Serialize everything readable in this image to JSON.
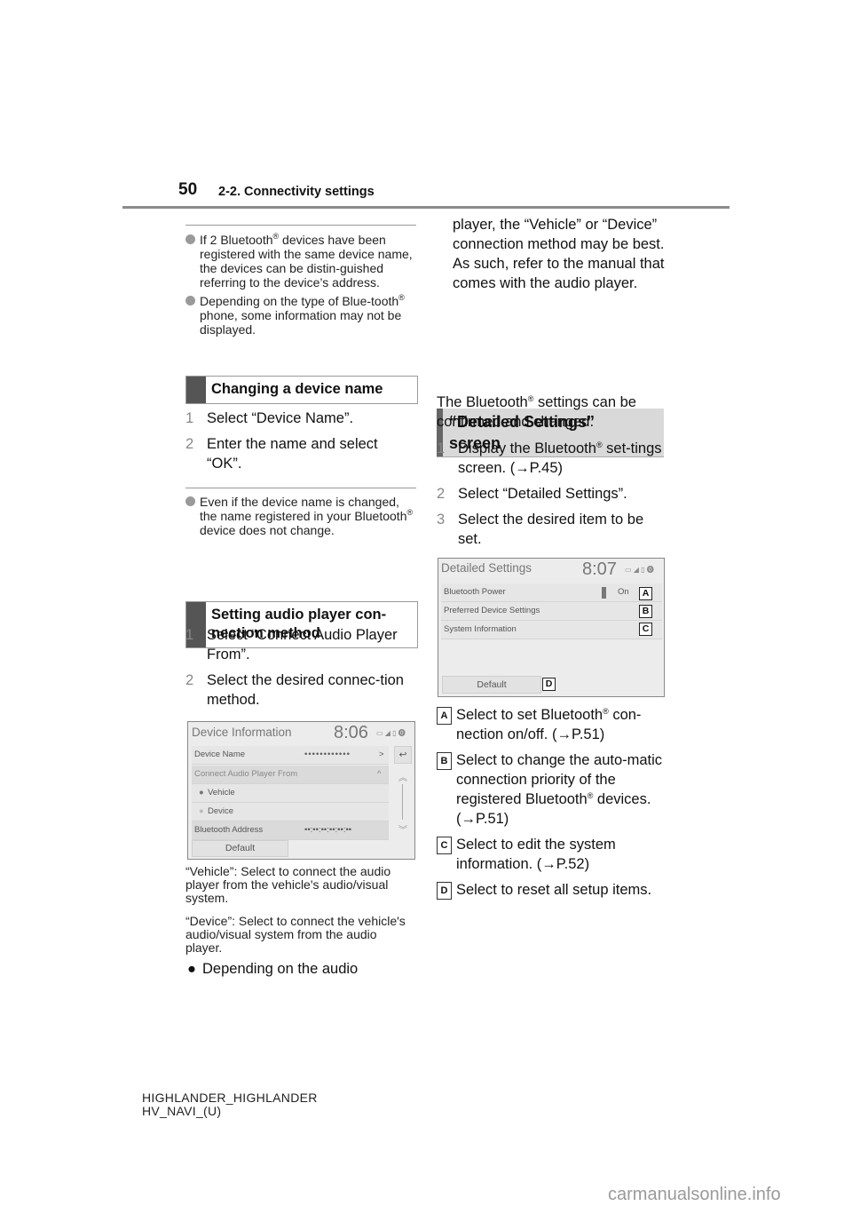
{
  "header": {
    "page_number": "50",
    "section_title": "2-2. Connectivity settings"
  },
  "left_column": {
    "notes_top": [
      {
        "pre": "If 2 Bluetooth",
        "sup": "®",
        "post": " devices have been registered with the same device name, the devices can be distin-guished referring to the device’s address."
      },
      {
        "pre": "Depending on the type of Blue-tooth",
        "sup": "®",
        "post": " phone, some information may not be displayed."
      }
    ],
    "section1": {
      "heading": "Changing a device name",
      "steps": [
        {
          "num": "1",
          "text": "Select “Device Name”."
        },
        {
          "num": "2",
          "text": "Enter the name and select “OK”."
        }
      ],
      "note": {
        "pre": "Even if the device name is changed, the name registered in your Bluetooth",
        "sup": "®",
        "post": " device does not change."
      }
    },
    "section2": {
      "heading": "Setting audio player con-nection method",
      "steps": [
        {
          "num": "1",
          "text": "Select “Connect Audio Player From”."
        },
        {
          "num": "2",
          "text": "Select the desired connec-tion method."
        }
      ]
    },
    "screen1": {
      "title": "Device Information",
      "clock": "8:06",
      "rows": [
        {
          "label": "Device Name",
          "value": "••••••••••••",
          "arrow": ">"
        },
        {
          "label": "Connect Audio Player From",
          "value": "",
          "arrow": "^"
        },
        {
          "label": "Vehicle",
          "value": "",
          "arrow": ""
        },
        {
          "label": "Device",
          "value": "",
          "arrow": ""
        },
        {
          "label": "Bluetooth Address",
          "value": "••:••:••:••:••:••",
          "arrow": ""
        }
      ],
      "default_button": "Default"
    },
    "captions": [
      "“Vehicle”: Select to connect the audio player from the vehicle's audio/visual system.",
      "“Device”: Select to connect the vehicle's audio/visual system from the audio player."
    ],
    "bullet_start": "Depending on the audio"
  },
  "right_column": {
    "continued_text": "player, the “Vehicle” or “Device” connection method may be best. As such, refer to the manual that comes with the audio player.",
    "section3": {
      "heading_line1": "“Detailed Settings”",
      "heading_line2": "screen"
    },
    "intro": {
      "pre": "The Bluetooth",
      "sup": "®",
      "post": " settings can be confirmed and changed."
    },
    "steps": [
      {
        "num": "1",
        "pre": "Display the Bluetooth",
        "sup": "®",
        "post": " set-tings screen. (→P.45)"
      },
      {
        "num": "2",
        "pre": "Select “Detailed Settings”.",
        "sup": "",
        "post": ""
      },
      {
        "num": "3",
        "pre": "Select the desired item to be set.",
        "sup": "",
        "post": ""
      }
    ],
    "screen2": {
      "title": "Detailed Settings",
      "clock": "8:07",
      "rows": [
        {
          "label": "Bluetooth Power",
          "toggle": "On",
          "callout": "A"
        },
        {
          "label": "Preferred Device Settings",
          "callout": "B"
        },
        {
          "label": "System Information",
          "callout": "C"
        }
      ],
      "default_button": "Default",
      "default_callout": "D"
    },
    "legend": [
      {
        "key": "A",
        "pre": "Select to set Bluetooth",
        "sup": "®",
        "post": " con-nection on/off. (→P.51)"
      },
      {
        "key": "B",
        "pre": "Select to change the auto-matic connection priority of the registered Bluetooth",
        "sup": "®",
        "post": " devices. (→P.51)"
      },
      {
        "key": "C",
        "pre": "Select to edit the system information. (→P.52)",
        "sup": "",
        "post": ""
      },
      {
        "key": "D",
        "pre": "Select to reset all setup items.",
        "sup": "",
        "post": ""
      }
    ]
  },
  "footer": {
    "line1": "HIGHLANDER_HIGHLANDER",
    "line2": "HV_NAVI_(U)"
  },
  "watermark": "carmanualsonline.info"
}
